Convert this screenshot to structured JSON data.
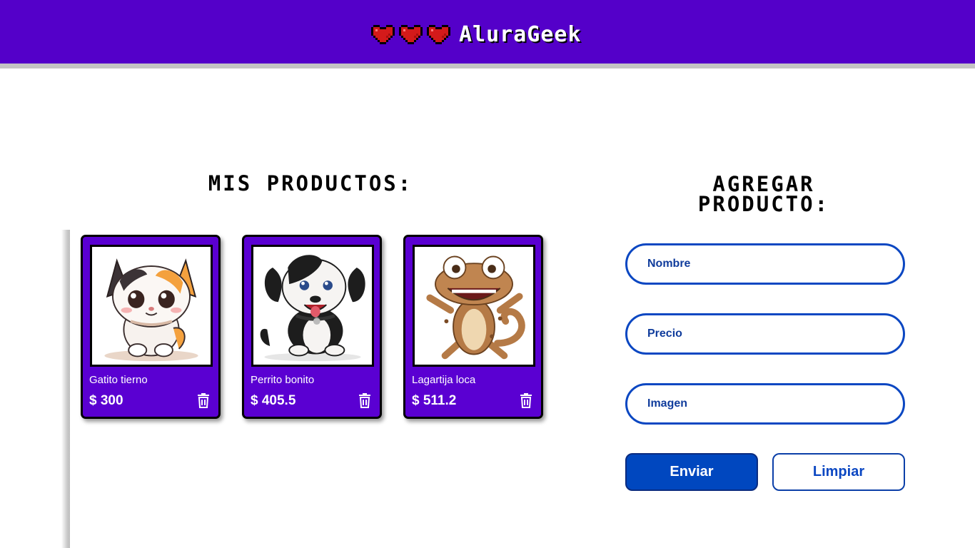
{
  "header": {
    "brand": "AluraGeek",
    "hearts": [
      "heart-icon",
      "heart-icon",
      "heart-icon"
    ],
    "background": "#5400c9",
    "heart_color": "#d41a1a"
  },
  "products_section": {
    "title": "MIS PRODUCTOS:",
    "items": [
      {
        "name": "Gatito tierno",
        "price": "$ 300",
        "image": "kitten-image",
        "delete_icon": "trash-icon"
      },
      {
        "name": "Perrito bonito",
        "price": "$ 405.5",
        "image": "puppy-image",
        "delete_icon": "trash-icon"
      },
      {
        "name": "Lagartija loca",
        "price": "$ 511.2",
        "image": "lizard-image",
        "delete_icon": "trash-icon"
      }
    ]
  },
  "form": {
    "title_line1": "AGREGAR",
    "title_line2": "PRODUCTO:",
    "name_placeholder": "Nombre",
    "price_placeholder": "Precio",
    "image_placeholder": "Imagen",
    "send_label": "Enviar",
    "clear_label": "Limpiar"
  },
  "colors": {
    "card": "#5a00d2",
    "accent": "#0047bf"
  }
}
